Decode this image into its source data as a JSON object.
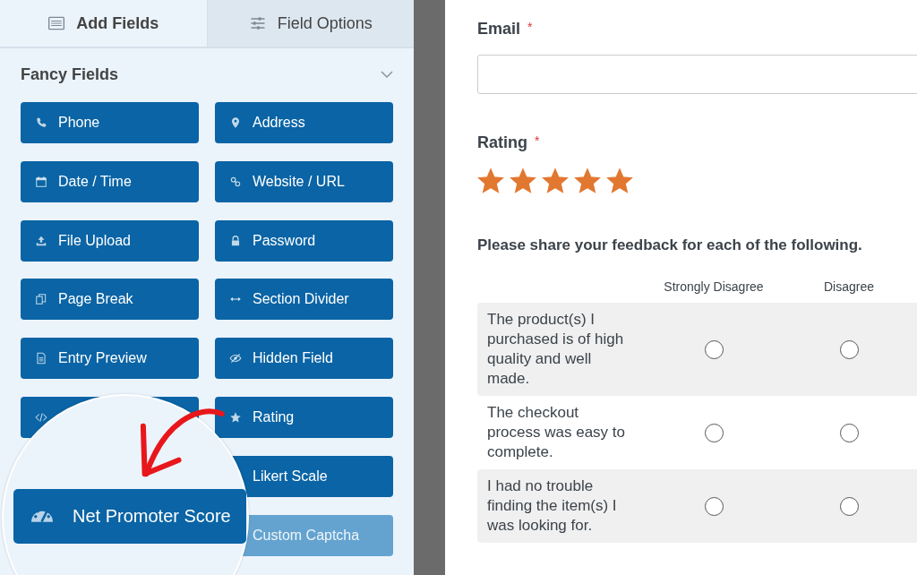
{
  "tabs": [
    {
      "label": "Add Fields",
      "kind": "list",
      "selected": true
    },
    {
      "label": "Field Options",
      "kind": "sliders",
      "selected": false
    }
  ],
  "fancy_fields": {
    "title": "Fancy Fields",
    "expanded": true,
    "items": [
      {
        "label": "Phone",
        "kind": "phone",
        "disabled": false
      },
      {
        "label": "Address",
        "kind": "pin",
        "disabled": false
      },
      {
        "label": "Date / Time",
        "kind": "calendar",
        "disabled": false
      },
      {
        "label": "Website / URL",
        "kind": "link",
        "disabled": false
      },
      {
        "label": "File Upload",
        "kind": "upload",
        "disabled": false
      },
      {
        "label": "Password",
        "kind": "lock",
        "disabled": false
      },
      {
        "label": "Page Break",
        "kind": "pages",
        "disabled": false
      },
      {
        "label": "Section Divider",
        "kind": "arrows",
        "disabled": false
      },
      {
        "label": "Entry Preview",
        "kind": "document",
        "disabled": false
      },
      {
        "label": "Hidden Field",
        "kind": "eye",
        "disabled": false
      },
      {
        "kind": "code",
        "disabled": false
      },
      {
        "label": "Rating",
        "kind": "star",
        "disabled": false
      },
      {
        "kind": "hidden"
      },
      {
        "label": "Likert Scale",
        "kind": "none",
        "disabled": false
      },
      {
        "kind": "hidden"
      },
      {
        "label": "Custom Captcha",
        "kind": "none",
        "disabled": true
      }
    ]
  },
  "magnifier": {
    "label": "Net Promoter Score",
    "kind": "gauge"
  },
  "form": {
    "email": {
      "label": "Email",
      "required_mark": "*"
    },
    "rating": {
      "label": "Rating",
      "required_mark": "*",
      "stars": 5
    },
    "likert": {
      "question": "Please share your feedback for each of the following.",
      "columns": [
        "Strongly Disagree",
        "Disagree"
      ],
      "rows": [
        {
          "statement": "The product(s) I purchased is of high quality and well made.",
          "choices": [
            {
              "checked": false
            },
            {
              "checked": false
            }
          ]
        },
        {
          "statement": "The checkout process was easy to complete.",
          "choices": [
            {
              "checked": false
            },
            {
              "checked": false
            }
          ]
        },
        {
          "statement": "I had no trouble finding the item(s) I was looking for.",
          "choices": [
            {
              "checked": false
            },
            {
              "checked": false
            }
          ]
        }
      ]
    }
  }
}
